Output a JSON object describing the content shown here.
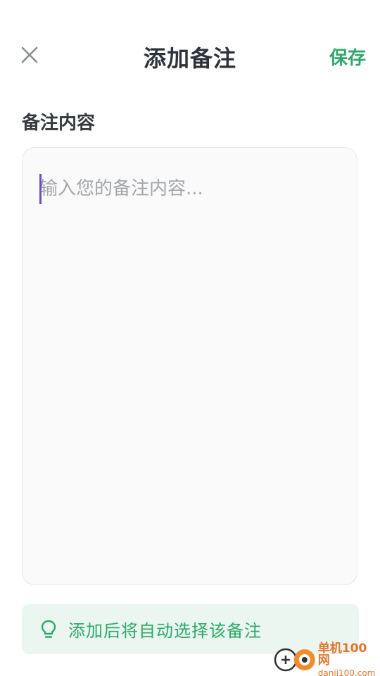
{
  "header": {
    "title": "添加备注",
    "save_label": "保存",
    "close_icon": "close-icon"
  },
  "note": {
    "section_label": "备注内容",
    "placeholder": "输入您的备注内容...",
    "value": ""
  },
  "tip": {
    "icon": "lightbulb-icon",
    "text": "添加后将自动选择该备注"
  },
  "watermark": {
    "name": "单机100网",
    "domain": "danji100.com"
  },
  "colors": {
    "accent": "#2fa96a",
    "title": "#2b333b",
    "tip_bg": "#eaf6ef",
    "caret": "#6c4fc4",
    "watermark": "#e8742b"
  }
}
